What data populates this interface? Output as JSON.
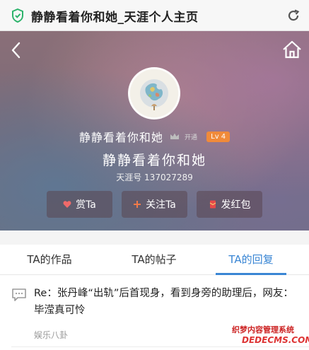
{
  "browser": {
    "title": "静静看着你和她_天涯个人主页"
  },
  "profile": {
    "name": "静静看着你和她",
    "vip_label": "开通",
    "level": "Lv 4",
    "tianya_id": "天涯号 137027289"
  },
  "actions": [
    {
      "label": "赏Ta",
      "icon": "heart-icon"
    },
    {
      "label": "关注Ta",
      "icon": "plus-icon"
    },
    {
      "label": "发红包",
      "icon": "red-envelope-icon"
    }
  ],
  "tabs": [
    {
      "label": "TA的作品",
      "active": false
    },
    {
      "label": "TA的帖子",
      "active": false
    },
    {
      "label": "TA的回复",
      "active": true
    }
  ],
  "posts": [
    {
      "title": "Re：张丹峰“出轨”后首现身，看到身旁的助理后，网友：毕滢真可怜",
      "category": "娱乐八卦"
    }
  ],
  "watermark": {
    "line1": "织梦内容管理系统",
    "line2": "DEDECMS.COM"
  },
  "colors": {
    "accent": "#3a86d4",
    "level_badge": "#f08a3a"
  }
}
